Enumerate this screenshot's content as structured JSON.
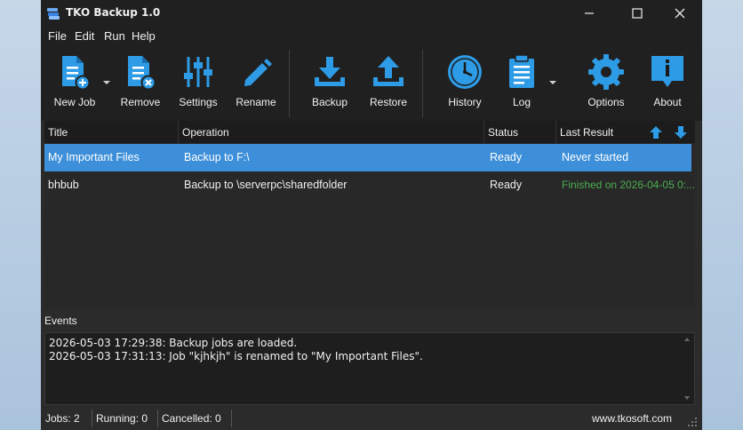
{
  "window": {
    "title": "TKO Backup 1.0"
  },
  "menu": [
    "File",
    "Edit",
    "Run",
    "Help"
  ],
  "toolbar": {
    "new_job": "New Job",
    "remove": "Remove",
    "settings": "Settings",
    "rename": "Rename",
    "backup": "Backup",
    "restore": "Restore",
    "history": "History",
    "log": "Log",
    "options": "Options",
    "about": "About"
  },
  "grid": {
    "columns": [
      "Title",
      "Operation",
      "Status",
      "Last Result"
    ],
    "rows": [
      {
        "title": "My Important Files",
        "operation": "Backup to F:\\",
        "status": "Ready",
        "last_result": "Never started"
      },
      {
        "title": "bhbub",
        "operation": "Backup to \\serverpc\\sharedfolder",
        "status": "Ready",
        "last_result": "Finished on 2026-04-05 0:..."
      }
    ]
  },
  "events": {
    "label": "Events",
    "lines": [
      "2026-05-03 17:29:38: Backup jobs are loaded.",
      "2026-05-03 17:31:13: Job \"kjhkjh\" is renamed to \"My Important Files\"."
    ]
  },
  "status": {
    "jobs": "Jobs: 2",
    "running": "Running: 0",
    "cancelled": "Cancelled: 0",
    "website": "www.tkosoft.com"
  },
  "colors": {
    "accent": "#2e9be6",
    "selection": "#3d8fd9",
    "success": "#4caf50"
  }
}
